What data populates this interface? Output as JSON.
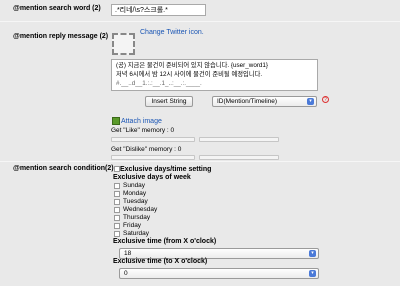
{
  "search_word": {
    "label": "@mention search word (2)",
    "value": ".*리네/\\s?스크롤.*"
  },
  "reply_message": {
    "label": "@mention reply message (2)",
    "change_icon_link": "Change Twitter icon.",
    "text_lines": [
      "(공) 지금은 물건이 준비되어 있지 않습니다. {user_word1}",
      "저녁 6시에서 밤 12시 사이에 물건이 준비될 예정입니다.",
      "#.__..d__1.:.:__.1_..:__.:.____."
    ],
    "insert_button": "Insert String",
    "insert_select": "ID(Mention/Timeline)",
    "help_icon": "?",
    "attach_link": "Attach image",
    "like_memory": "Get \"Like\" memory : 0",
    "dislike_memory": "Get \"Dislike\" memory : 0"
  },
  "search_condition": {
    "label": "@mention search condition(2)",
    "exclusive_checkbox": "Exclusive days/time setting",
    "days_heading": "Exclusive days of week",
    "days": [
      "Sunday",
      "Monday",
      "Tuesday",
      "Wednesday",
      "Thursday",
      "Friday",
      "Saturday"
    ],
    "from_label": "Exclusive time (from X o'clock)",
    "from_value": "18",
    "to_label": "Exclusive time (to X o'clock)",
    "to_value": "0"
  }
}
